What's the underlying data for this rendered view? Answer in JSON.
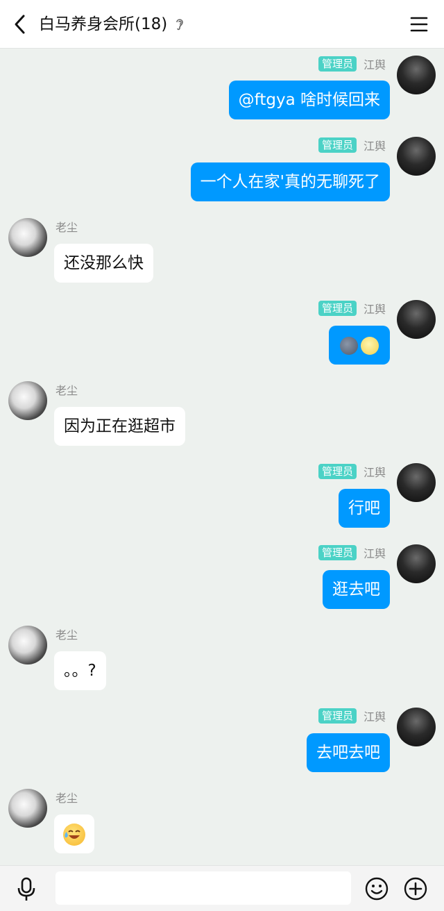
{
  "header": {
    "title": "白马养身会所(18)"
  },
  "labels": {
    "admin_badge": "管理员",
    "self_name": "江舆",
    "other_name": "老尘"
  },
  "messages": [
    {
      "from": "self",
      "text": "@ftgya 啥时候回来"
    },
    {
      "from": "self",
      "text": "一个人在家'真的无聊死了"
    },
    {
      "from": "other",
      "text": "还没那么快"
    },
    {
      "from": "self",
      "text": "",
      "emoji": [
        "new-moon-face",
        "full-moon-face"
      ]
    },
    {
      "from": "other",
      "text": "因为正在逛超市"
    },
    {
      "from": "self",
      "text": "行吧"
    },
    {
      "from": "self",
      "text": "逛去吧"
    },
    {
      "from": "other",
      "text": "。。?"
    },
    {
      "from": "self",
      "text": "去吧去吧"
    },
    {
      "from": "other",
      "text": "",
      "emoji": [
        "laughing-tears-face"
      ]
    }
  ],
  "composer": {
    "input_value": "",
    "placeholder": ""
  },
  "icons": {
    "back": "chevron-left-icon",
    "ear": "ear-icon",
    "menu": "hamburger-menu-icon",
    "mic": "microphone-icon",
    "emoji": "smiley-icon",
    "plus": "plus-circle-icon"
  },
  "colors": {
    "self_bubble": "#0099ff",
    "other_bubble": "#ffffff",
    "admin_badge": "#4bd2c6",
    "chat_background": "#edf1ee"
  }
}
